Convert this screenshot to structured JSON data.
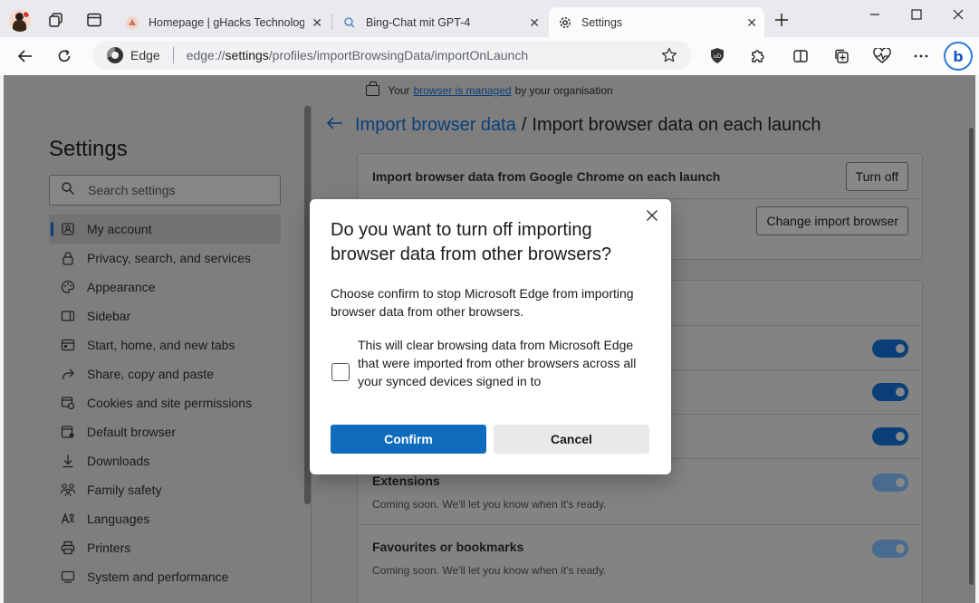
{
  "tabs": [
    {
      "title": "Homepage | gHacks Technology",
      "active": false
    },
    {
      "title": "Bing-Chat mit GPT-4",
      "active": false
    },
    {
      "title": "Settings",
      "active": true
    }
  ],
  "address_bar": {
    "badge": "Edge",
    "url_prefix": "edge://",
    "url_host": "settings",
    "url_path": "/profiles/importBrowsingData/importOnLaunch"
  },
  "banner": {
    "prefix": "Your",
    "link": "browser is managed",
    "suffix": "by your organisation"
  },
  "sidebar": {
    "title": "Settings",
    "search_placeholder": "Search settings",
    "items": [
      {
        "label": "My account",
        "icon": "account-icon",
        "selected": true
      },
      {
        "label": "Privacy, search, and services",
        "icon": "lock-icon"
      },
      {
        "label": "Appearance",
        "icon": "palette-icon"
      },
      {
        "label": "Sidebar",
        "icon": "sidebar-icon"
      },
      {
        "label": "Start, home, and new tabs",
        "icon": "home-tabs-icon"
      },
      {
        "label": "Share, copy and paste",
        "icon": "share-icon"
      },
      {
        "label": "Cookies and site permissions",
        "icon": "cookies-icon"
      },
      {
        "label": "Default browser",
        "icon": "browser-icon"
      },
      {
        "label": "Downloads",
        "icon": "download-icon"
      },
      {
        "label": "Family safety",
        "icon": "family-icon"
      },
      {
        "label": "Languages",
        "icon": "languages-icon"
      },
      {
        "label": "Printers",
        "icon": "printer-icon"
      },
      {
        "label": "System and performance",
        "icon": "system-icon"
      }
    ]
  },
  "breadcrumb": {
    "parent": "Import browser data",
    "separator": "/",
    "current": "Import browser data on each launch"
  },
  "card1": {
    "label": "Import browser data from Google Chrome on each launch",
    "turn_off": "Turn off",
    "change_browser": "Change import browser"
  },
  "card2": {
    "extensions_label": "Extensions",
    "extensions_sub": "Coming soon. We'll let you know when it's ready.",
    "favourites_label": "Favourites or bookmarks",
    "favourites_sub": "Coming soon. We'll let you know when it's ready."
  },
  "dialog": {
    "title": "Do you want to turn off importing browser data from other browsers?",
    "body": "Choose confirm to stop Microsoft Edge from importing browser data from other browsers.",
    "checkbox_label": "This will clear browsing data from Microsoft Edge that were imported from other browsers across all your synced devices signed in to",
    "checkbox_checked": false,
    "confirm": "Confirm",
    "cancel": "Cancel"
  },
  "colors": {
    "accent": "#0f6cbd",
    "link": "#0a3f79",
    "overlay_bg": "#7e7e7e"
  }
}
